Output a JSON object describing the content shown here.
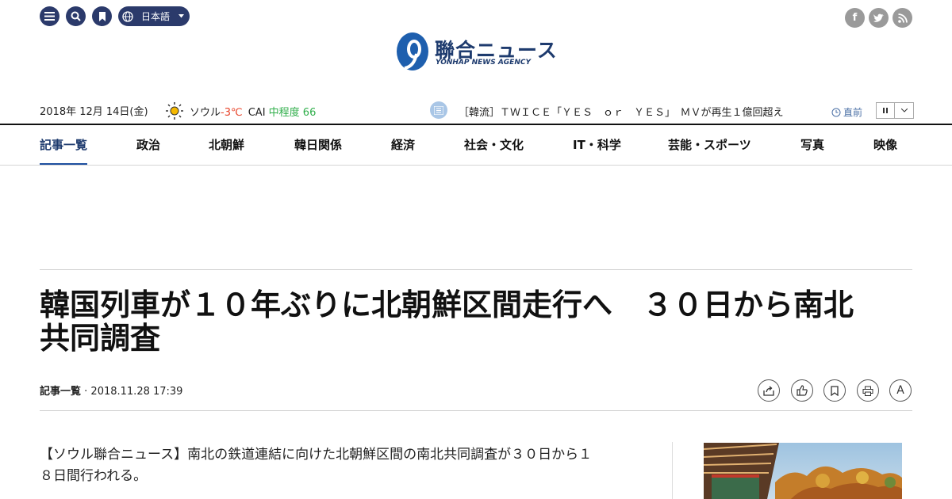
{
  "header": {
    "language": "日本語",
    "logo_text": "聯合ニュース",
    "logo_sub": "YONHAP NEWS AGENCY"
  },
  "infobar": {
    "date": "2018年 12月 14日(金)",
    "city": "ソウル",
    "temp": "-3℃",
    "cai_label": "CAI",
    "cai_value": "中程度 66",
    "ticker": "［韓流］ＴＷＩＣＥ「ＹＥＳ　ｏｒ　ＹＥＳ」　ＭＶが再生１億回超え",
    "latest_label": "直前"
  },
  "nav": {
    "items": [
      "記事一覧",
      "政治",
      "北朝鮮",
      "韓日関係",
      "経済",
      "社会・文化",
      "IT・科学",
      "芸能・スポーツ",
      "写真",
      "映像"
    ]
  },
  "article": {
    "title_line1": "韓国列車が１０年ぶりに北朝鮮区間走行へ　３０日から南北",
    "title_line2": "共同調査",
    "category": "記事一覧",
    "datetime": "2018.11.28 17:39",
    "lead_line1": "【ソウル聯合ニュース】南北の鉄道連結に向けた北朝鮮区間の南北共同調査が３０日から１",
    "lead_line2": "８日間行われる。",
    "font_button": "A"
  },
  "colors": {
    "navy": "#2b3a6b",
    "temp": "#e8452b",
    "cai": "#2fae4a",
    "nav_active": "#1e4fa0"
  }
}
